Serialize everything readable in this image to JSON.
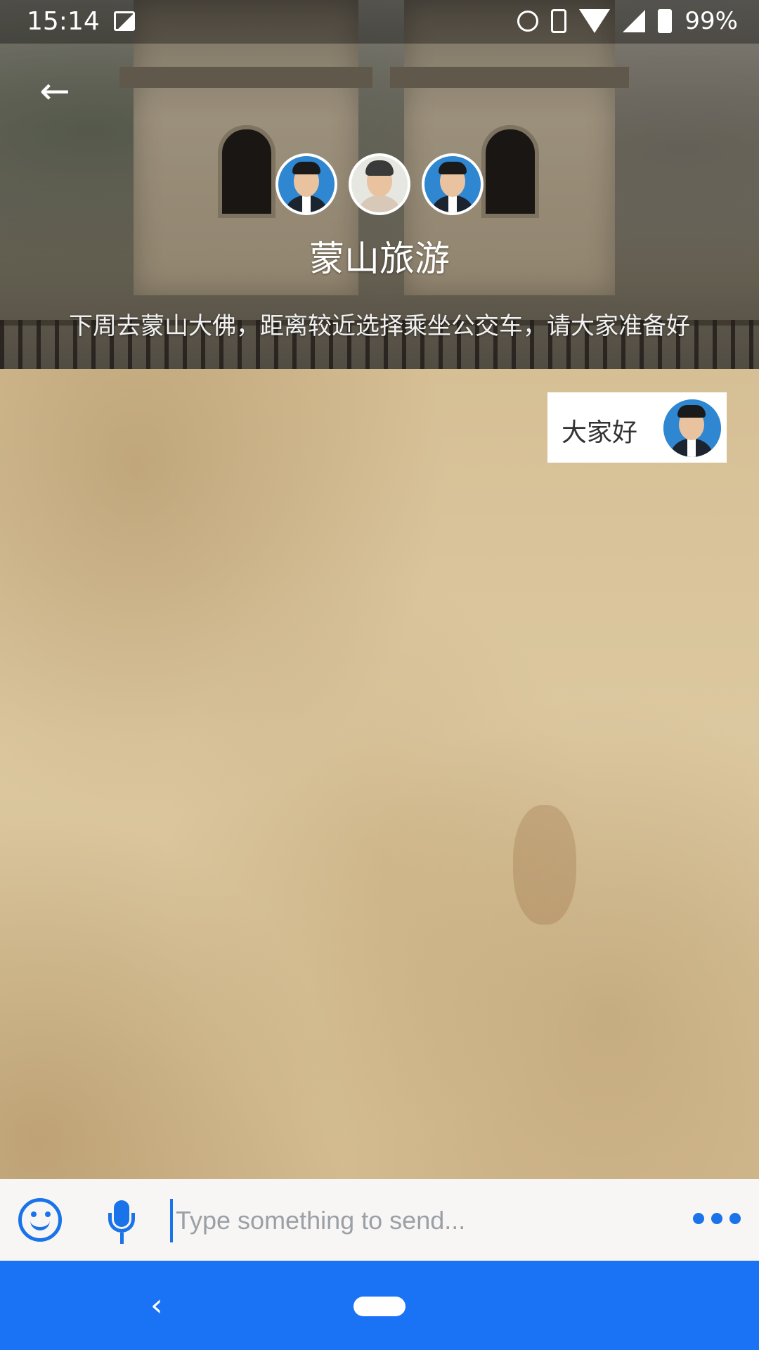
{
  "status_bar": {
    "time": "15:14",
    "battery": "99%",
    "icons": [
      "image-icon",
      "alarm-icon",
      "vibrate-icon",
      "wifi-icon",
      "signal-icon",
      "battery-icon"
    ]
  },
  "header": {
    "back_icon": "arrow-left-icon",
    "back_glyph": "←",
    "title": "蒙山旅游",
    "notice": "下周去蒙山大佛，距离较近选择乘坐公交车，请大家准备好",
    "member_avatars": [
      "avatar-1",
      "avatar-2",
      "avatar-3"
    ]
  },
  "messages": [
    {
      "text": "大家好",
      "side": "right"
    }
  ],
  "input_bar": {
    "placeholder": "Type something to send...",
    "value": "",
    "emoji_icon": "emoji-icon",
    "mic_icon": "microphone-icon",
    "more_icon": "more-dots-icon"
  },
  "nav_bar": {
    "back_glyph": "‹"
  },
  "colors": {
    "accent": "#1a73e8",
    "nav_bar": "#1a73f5",
    "parchment": "#d8c39c"
  }
}
